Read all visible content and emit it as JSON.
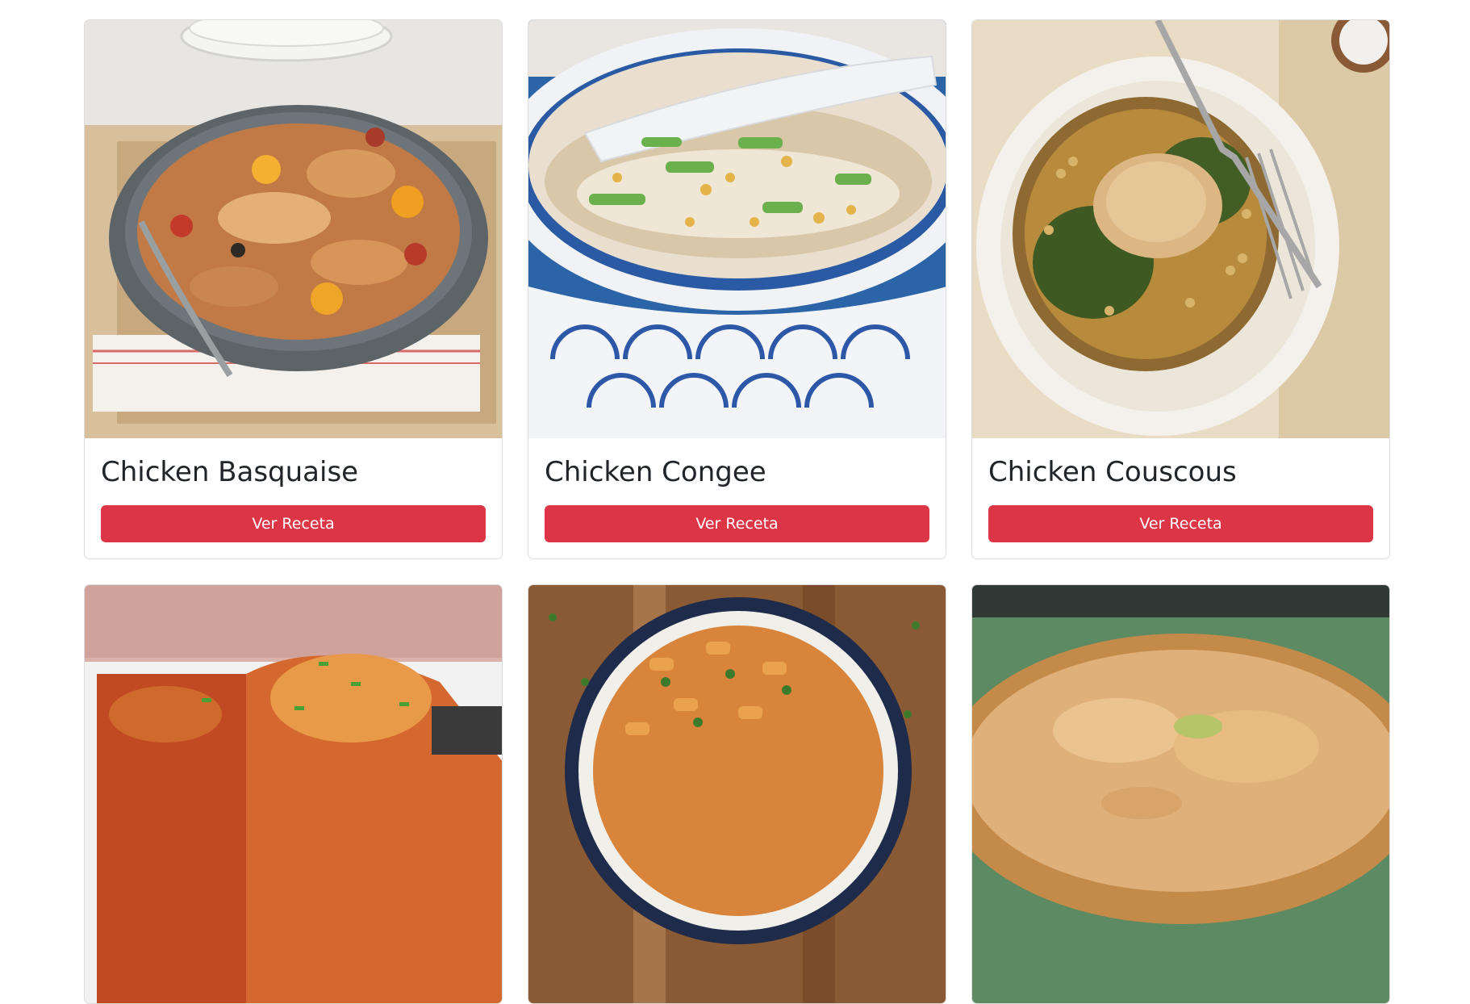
{
  "recipes": [
    {
      "title": "Chicken Basquaise",
      "button_label": "Ver Receta"
    },
    {
      "title": "Chicken Congee",
      "button_label": "Ver Receta"
    },
    {
      "title": "Chicken Couscous",
      "button_label": "Ver Receta"
    },
    {
      "title": "",
      "button_label": ""
    },
    {
      "title": "",
      "button_label": ""
    },
    {
      "title": "",
      "button_label": ""
    }
  ],
  "colors": {
    "button": "#dc3545",
    "button_text": "#ffffff",
    "title_text": "#212529",
    "card_border": "#dcdcdc"
  }
}
